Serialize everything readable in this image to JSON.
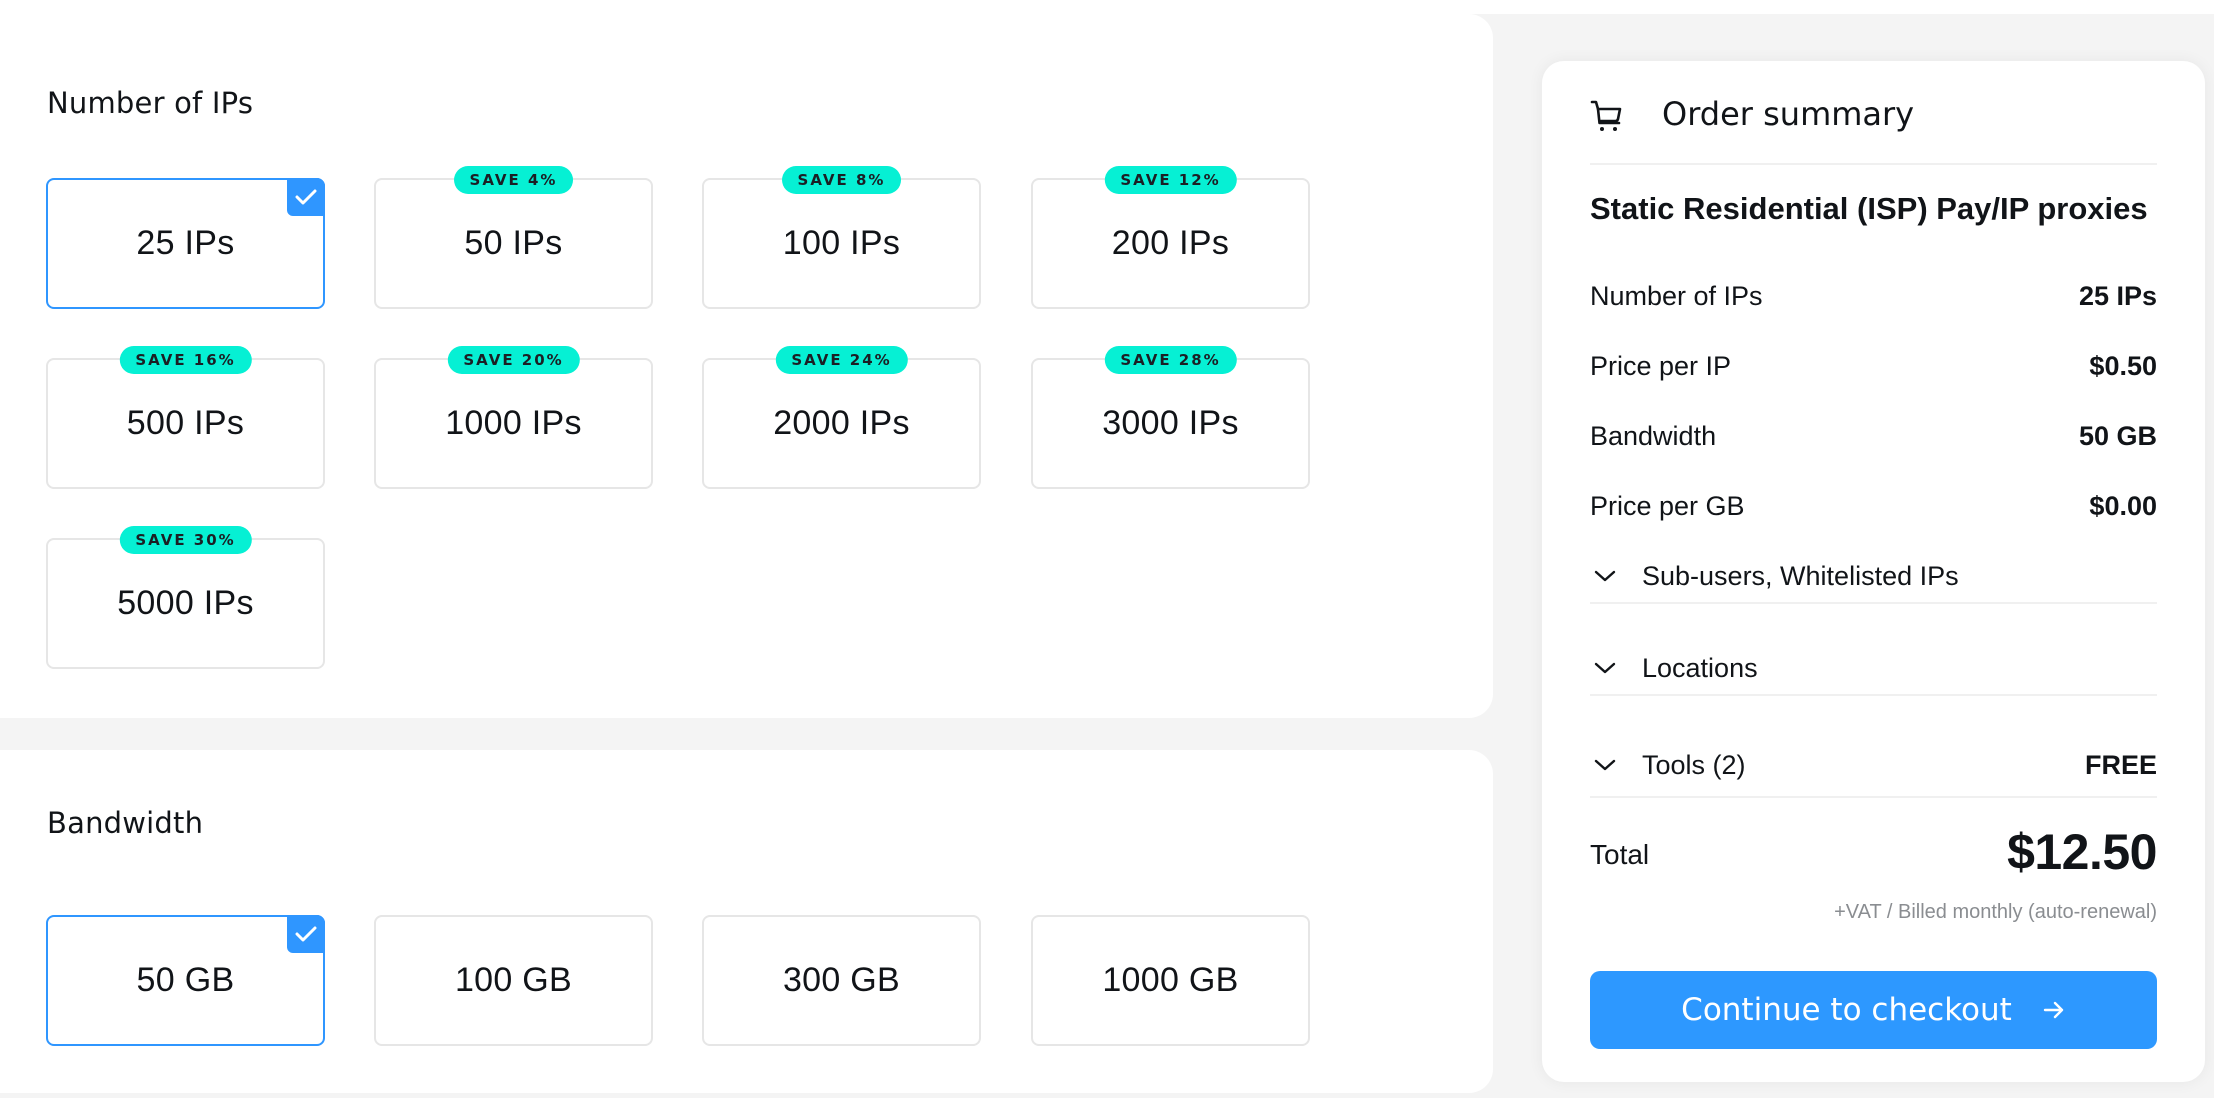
{
  "ips_section": {
    "title": "Number of IPs",
    "options": [
      {
        "label": "25 IPs",
        "badge": null,
        "selected": true
      },
      {
        "label": "50 IPs",
        "badge": "SAVE 4%",
        "selected": false
      },
      {
        "label": "100 IPs",
        "badge": "SAVE 8%",
        "selected": false
      },
      {
        "label": "200 IPs",
        "badge": "SAVE 12%",
        "selected": false
      },
      {
        "label": "500 IPs",
        "badge": "SAVE 16%",
        "selected": false
      },
      {
        "label": "1000 IPs",
        "badge": "SAVE 20%",
        "selected": false
      },
      {
        "label": "2000 IPs",
        "badge": "SAVE 24%",
        "selected": false
      },
      {
        "label": "3000 IPs",
        "badge": "SAVE 28%",
        "selected": false
      },
      {
        "label": "5000 IPs",
        "badge": "SAVE 30%",
        "selected": false
      }
    ]
  },
  "bandwidth_section": {
    "title": "Bandwidth",
    "options": [
      {
        "label": "50 GB",
        "selected": true
      },
      {
        "label": "100 GB",
        "selected": false
      },
      {
        "label": "300 GB",
        "selected": false
      },
      {
        "label": "1000 GB",
        "selected": false
      }
    ]
  },
  "summary": {
    "icon": "shopping-cart-icon",
    "title": "Order summary",
    "product_name": "Static Residential (ISP) Pay/IP proxies",
    "lines": [
      {
        "label": "Number of IPs",
        "value": "25 IPs"
      },
      {
        "label": "Price per IP",
        "value": "$0.50"
      },
      {
        "label": "Bandwidth",
        "value": "50 GB"
      },
      {
        "label": "Price per GB",
        "value": "$0.00"
      }
    ],
    "collapsibles": [
      {
        "label": "Sub-users, Whitelisted IPs",
        "value": ""
      },
      {
        "label": "Locations",
        "value": ""
      },
      {
        "label": "Tools (2)",
        "value": "FREE"
      }
    ],
    "total_label": "Total",
    "total_value": "$12.50",
    "billing_note": "+VAT / Billed monthly (auto-renewal)",
    "checkout_label": "Continue to checkout"
  },
  "colors": {
    "accent": "#2d98ff",
    "badge": "#06f0d4",
    "background": "#f4f4f4"
  }
}
